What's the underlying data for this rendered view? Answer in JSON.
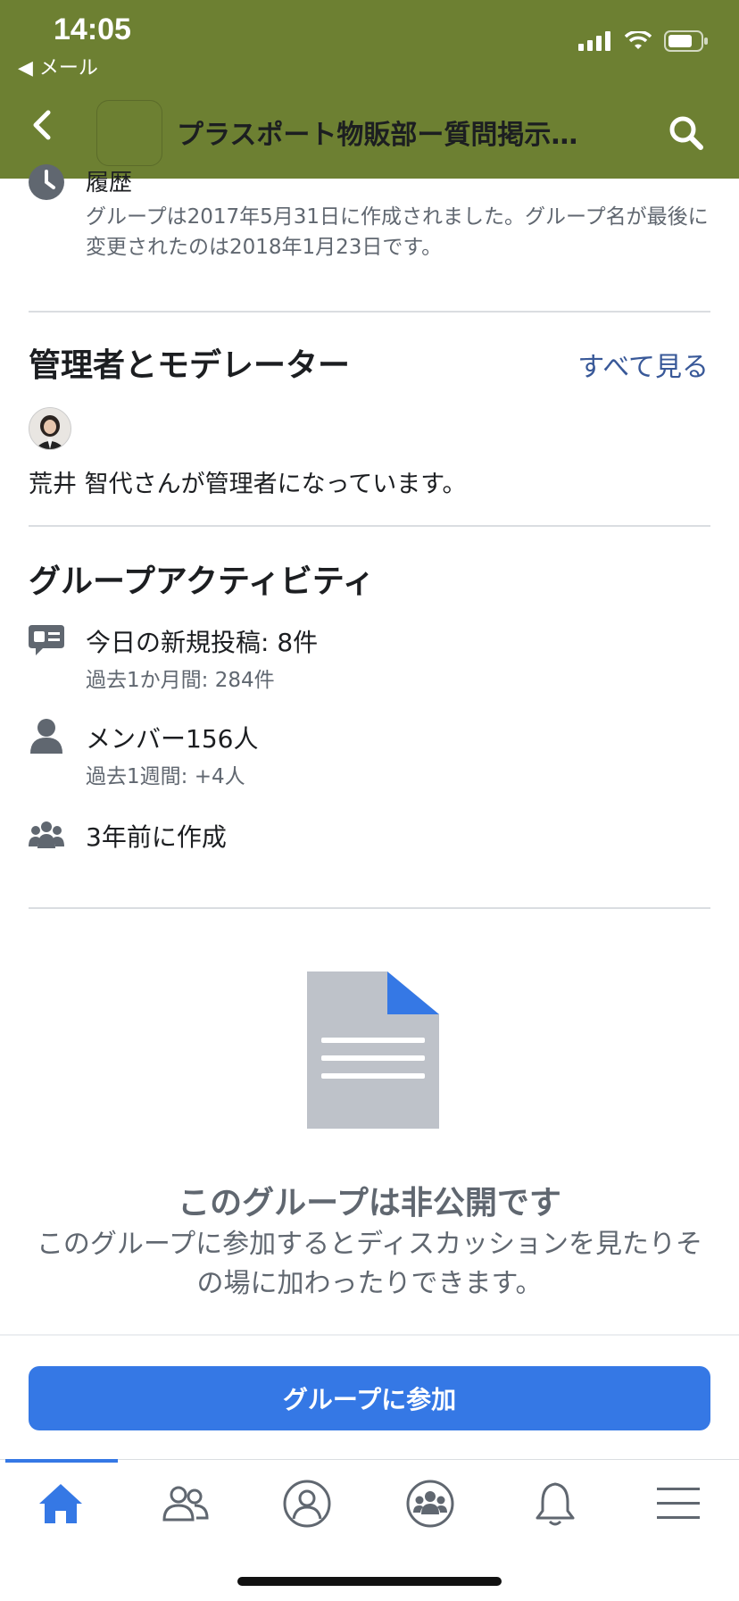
{
  "status_bar": {
    "time": "14:05",
    "back_label": "◀ メール"
  },
  "header": {
    "title": "プラスポート物販部ー質問掲示…",
    "background_color": "#6d8032"
  },
  "history": {
    "title": "履歴",
    "text": "グループは2017年5月31日に作成されました。グループ名が最後に変更されたのは2018年1月23日です。"
  },
  "admins": {
    "title": "管理者とモデレーター",
    "see_all": "すべて見る",
    "admin_text": "荒井 智代さんが管理者になっています。"
  },
  "activity": {
    "title": "グループアクティビティ",
    "posts_today": "今日の新規投稿: 8件",
    "posts_month": "過去1か月間: 284件",
    "members": "メンバー156人",
    "members_week": "過去1週間: +4人",
    "created": "3年前に作成"
  },
  "private_notice": {
    "title": "このグループは非公開です",
    "text": "このグループに参加するとディスカッションを見たりその場に加わったりできます。"
  },
  "join_button": {
    "label": "グループに参加",
    "color": "#3578e5"
  },
  "tabbar": {
    "items": [
      "home-icon",
      "friends-icon",
      "profile-icon",
      "groups-icon",
      "notifications-icon",
      "menu-icon"
    ],
    "active_index": 0
  }
}
